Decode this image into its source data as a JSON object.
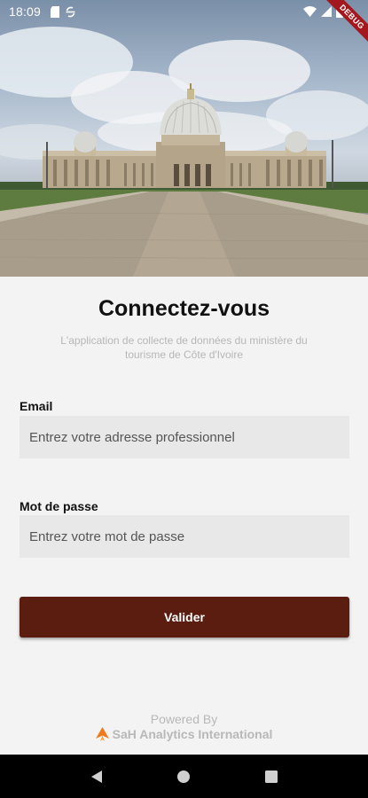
{
  "status_bar": {
    "time": "18:09",
    "debug_label": "DEBUG"
  },
  "hero": {
    "image_subject": "basilica-photo"
  },
  "login": {
    "title": "Connectez-vous",
    "subtitle": "L'application de collecte de données du ministère du tourisme de Côte d'Ivoire",
    "email_label": "Email",
    "email_placeholder": "Entrez votre adresse professionnel",
    "email_value": "",
    "password_label": "Mot de passe",
    "password_placeholder": "Entrez votre mot de passe",
    "password_value": "",
    "submit_label": "Valider"
  },
  "footer": {
    "powered_by": "Powered By",
    "brand_name": "SaH Analytics International"
  },
  "colors": {
    "primary_button": "#5a1d10",
    "brand_accent": "#f07a1a",
    "debug_ribbon": "#a3181e"
  }
}
